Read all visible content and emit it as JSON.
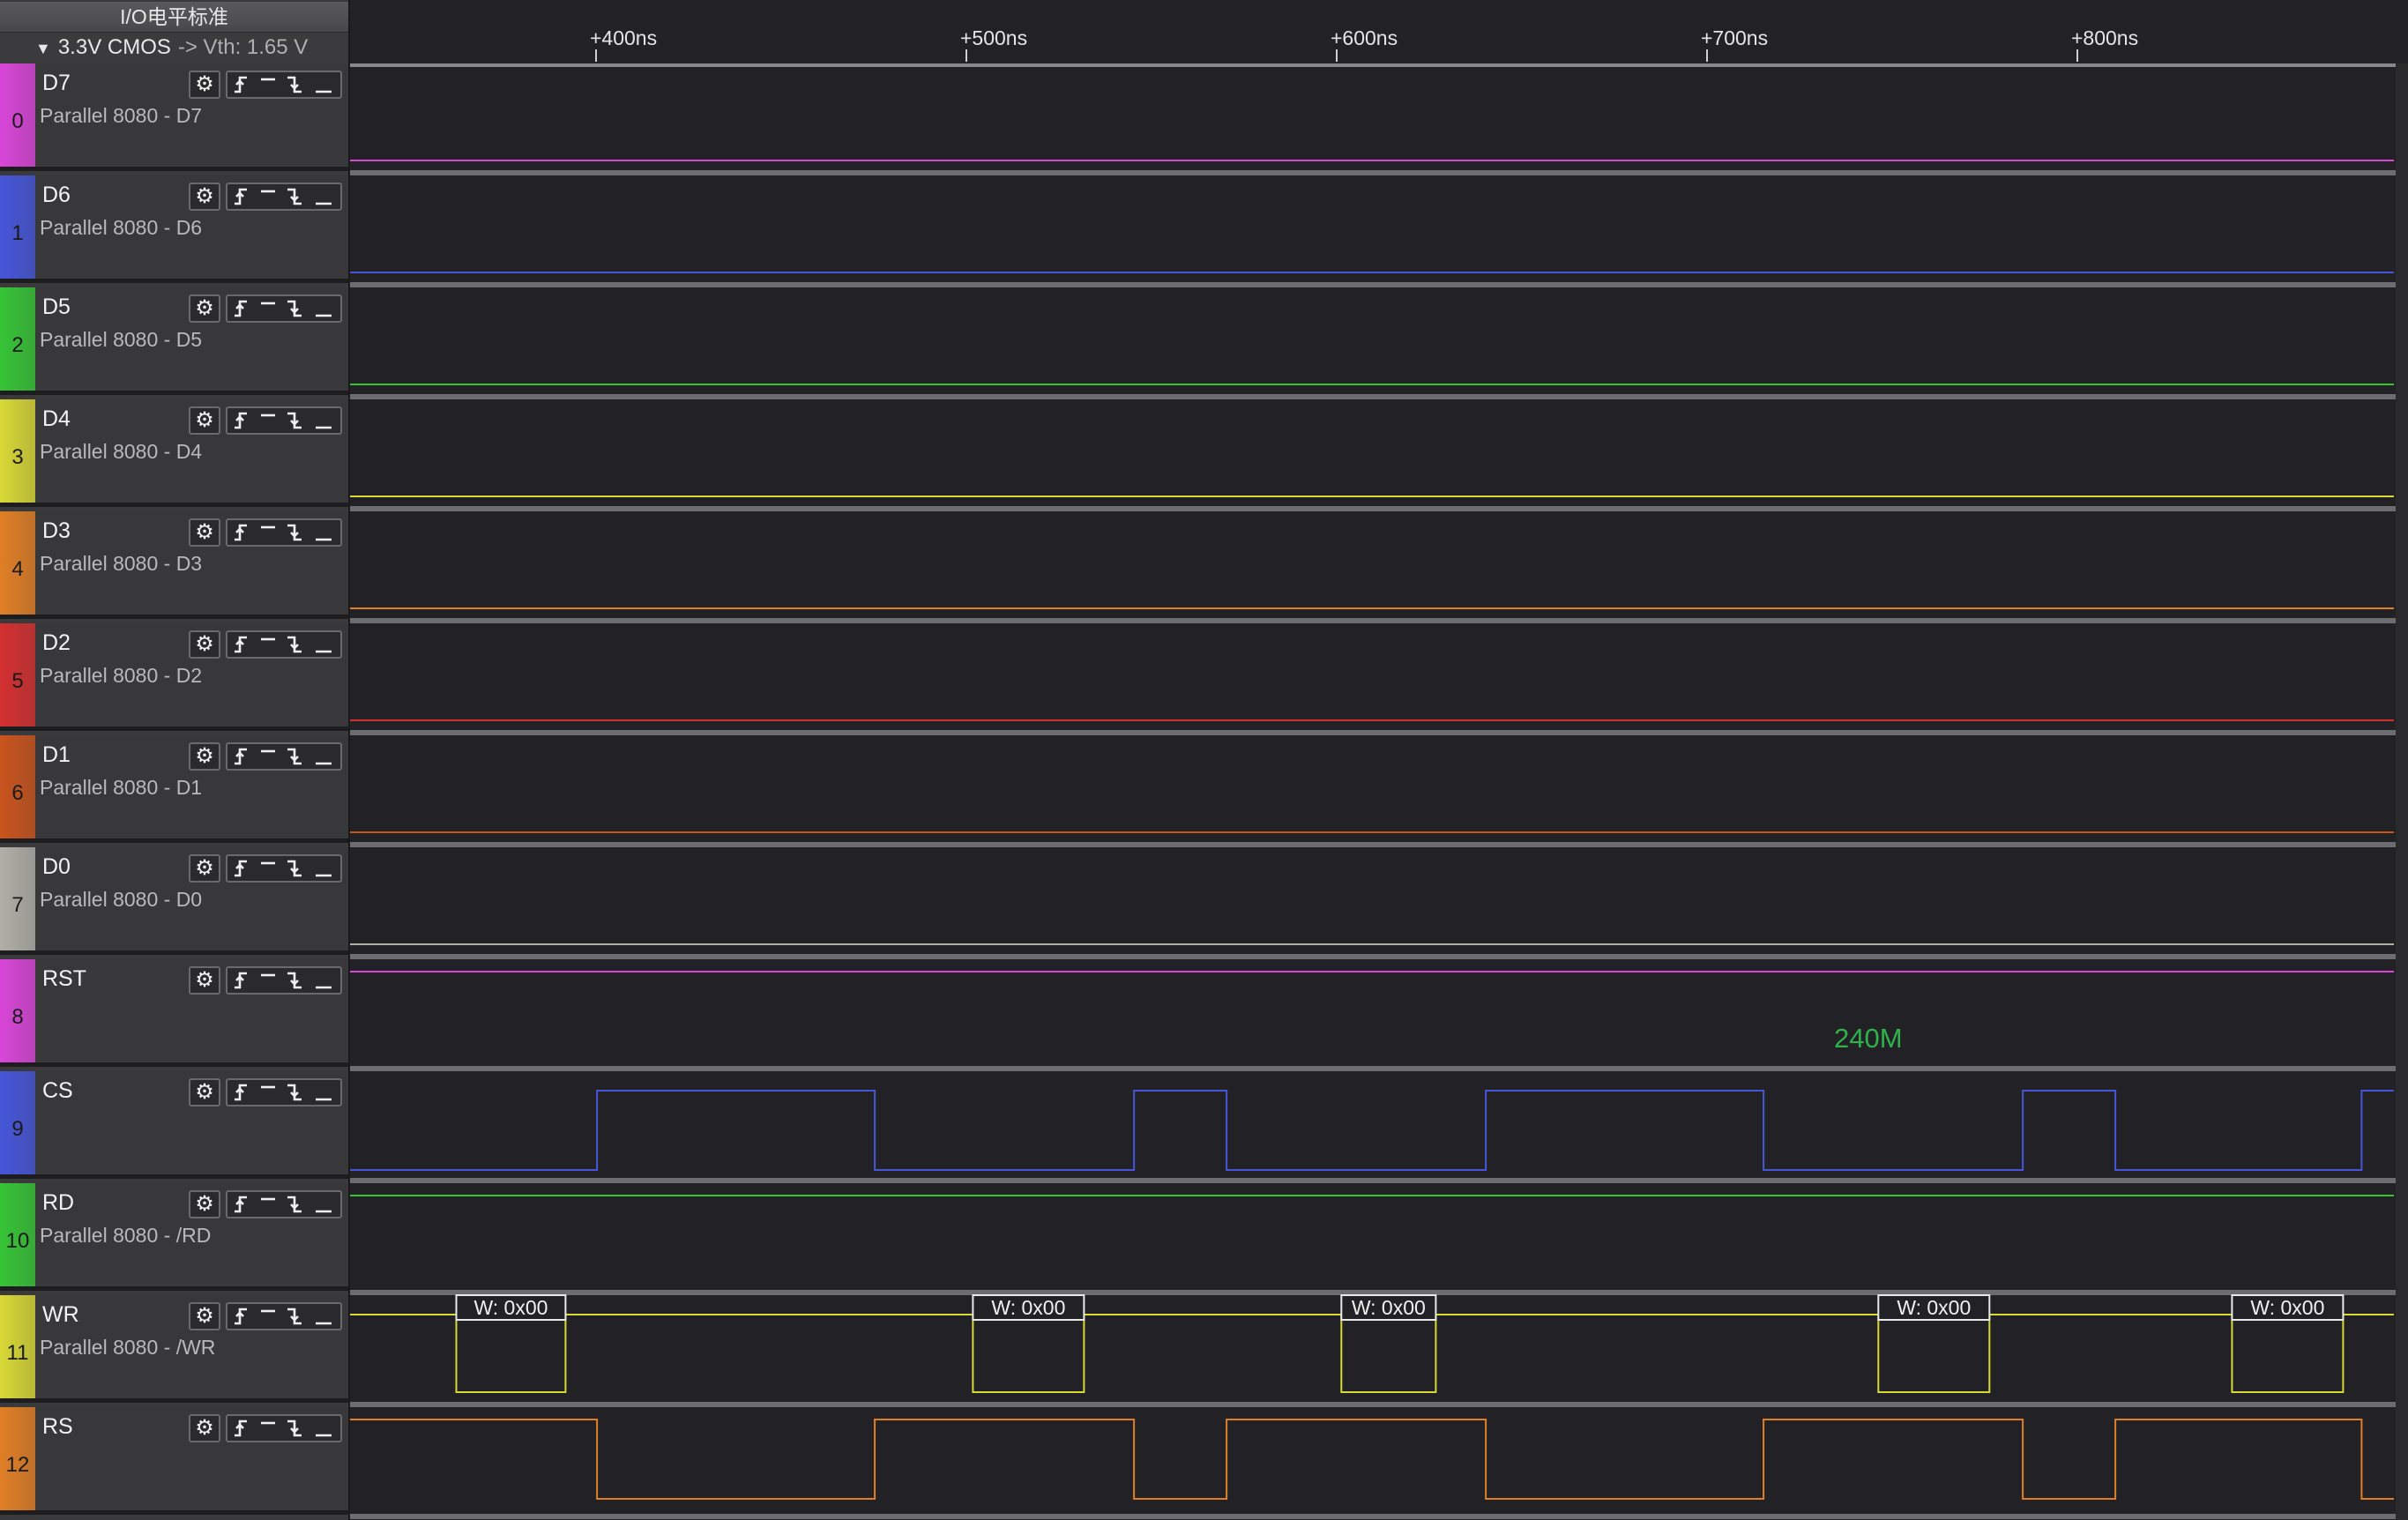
{
  "io_header": {
    "title": "I/O电平标准",
    "level": "3.3V CMOS",
    "vth": "-> Vth: 1.65 V"
  },
  "time_ticks": [
    "+400ns",
    "+500ns",
    "+600ns",
    "+700ns",
    "+800ns"
  ],
  "channels": [
    {
      "index": "0",
      "name": "D7",
      "desc": "Parallel 8080 - D7",
      "color": "#d946d9",
      "wave": "low"
    },
    {
      "index": "1",
      "name": "D6",
      "desc": "Parallel 8080 - D6",
      "color": "#4656d8",
      "wave": "low"
    },
    {
      "index": "2",
      "name": "D5",
      "desc": "Parallel 8080 - D5",
      "color": "#37c437",
      "wave": "low"
    },
    {
      "index": "3",
      "name": "D4",
      "desc": "Parallel 8080 - D4",
      "color": "#d8d837",
      "wave": "low"
    },
    {
      "index": "4",
      "name": "D3",
      "desc": "Parallel 8080 - D3",
      "color": "#e07f26",
      "wave": "low"
    },
    {
      "index": "5",
      "name": "D2",
      "desc": "Parallel 8080 - D2",
      "color": "#d43030",
      "wave": "low"
    },
    {
      "index": "6",
      "name": "D1",
      "desc": "Parallel 8080 - D1",
      "color": "#c9541e",
      "wave": "low"
    },
    {
      "index": "7",
      "name": "D0",
      "desc": "Parallel 8080 - D0",
      "color": "#b0b0a8",
      "wave": "low"
    },
    {
      "index": "8",
      "name": "RST",
      "desc": "",
      "color": "#d946d9",
      "wave": "high",
      "annotation": "240M"
    },
    {
      "index": "9",
      "name": "CS",
      "desc": "",
      "color": "#4656d8",
      "wave": "cs"
    },
    {
      "index": "10",
      "name": "RD",
      "desc": "Parallel 8080 - /RD",
      "color": "#37c437",
      "wave": "high"
    },
    {
      "index": "11",
      "name": "WR",
      "desc": "Parallel 8080 - /WR",
      "color": "#d8d837",
      "wave": "wr"
    },
    {
      "index": "12",
      "name": "RS",
      "desc": "",
      "color": "#e07f26",
      "wave": "rs"
    }
  ],
  "wr_decode_label": "W: 0x00",
  "icons": {
    "gear": "gear-icon",
    "trigger": [
      "rising-edge-icon",
      "high-level-icon",
      "falling-edge-icon",
      "low-level-icon"
    ]
  }
}
